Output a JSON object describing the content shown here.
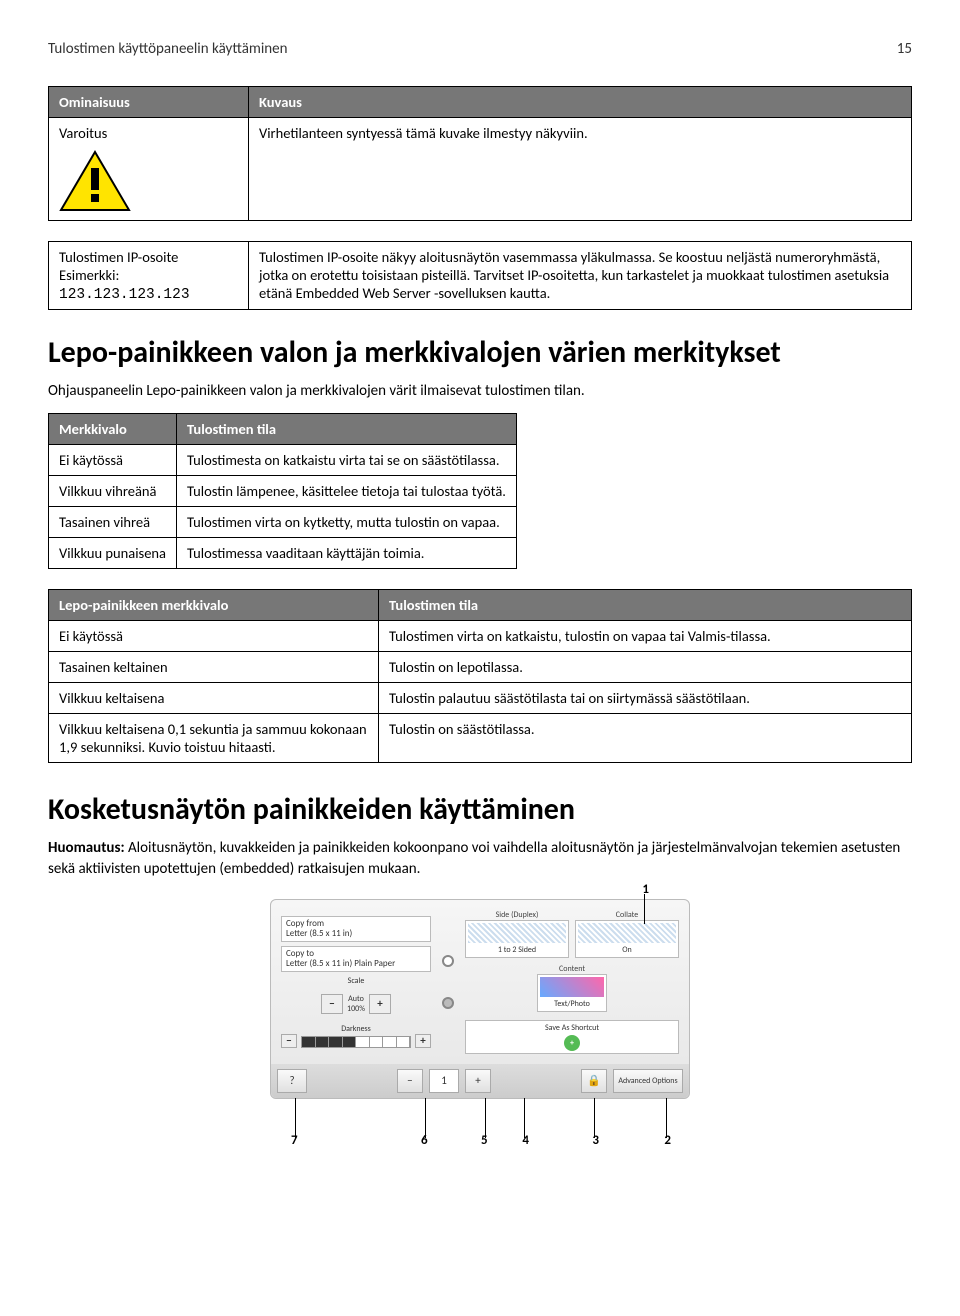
{
  "header": {
    "title": "Tulostimen käyttöpaneelin käyttäminen",
    "page": "15"
  },
  "table1": {
    "col1": "Ominaisuus",
    "col2": "Kuvaus",
    "row1_feature": "Varoitus",
    "row1_desc": "Virhetilanteen syntyessä tämä kuvake ilmestyy näkyviin."
  },
  "table2": {
    "row1_col1_line1": "Tulostimen IP-osoite",
    "row1_col1_line2_prefix": "Esimerkki: ",
    "row1_col1_line2_ip": "123.123.123.123",
    "row1_desc": "Tulostimen IP-osoite näkyy aloitusnäytön vasemmassa yläkulmassa. Se koostuu neljästä numeroryhmästä, jotka on erotettu toisistaan pisteillä. Tarvitset IP-osoitetta, kun tarkastelet ja muokkaat tulostimen asetuksia etänä Embedded Web Server -sovelluksen kautta."
  },
  "h1": "Lepo-painikkeen valon ja merkkivalojen värien merkitykset",
  "p1": "Ohjauspaneelin Lepo-painikkeen valon ja merkkivalojen värit ilmaisevat tulostimen tilan.",
  "table3": {
    "h1": "Merkkivalo",
    "h2": "Tulostimen tila",
    "rows": [
      {
        "a": "Ei käytössä",
        "b": "Tulostimesta on katkaistu virta tai se on säästötilassa."
      },
      {
        "a": "Vilkkuu vihreänä",
        "b": "Tulostin lämpenee, käsittelee tietoja tai tulostaa työtä."
      },
      {
        "a": "Tasainen vihreä",
        "b": "Tulostimen virta on kytketty, mutta tulostin on vapaa."
      },
      {
        "a": "Vilkkuu punaisena",
        "b": "Tulostimessa vaaditaan käyttäjän toimia."
      }
    ]
  },
  "table4": {
    "h1": "Lepo-painikkeen merkkivalo",
    "h2": "Tulostimen tila",
    "rows": [
      {
        "a": "Ei käytössä",
        "b": "Tulostimen virta on katkaistu, tulostin on vapaa tai Valmis-tilassa."
      },
      {
        "a": "Tasainen keltainen",
        "b": "Tulostin on lepotilassa."
      },
      {
        "a": "Vilkkuu keltaisena",
        "b": "Tulostin palautuu säästötilasta tai on siirtymässä säästötilaan."
      },
      {
        "a": "Vilkkuu keltaisena 0,1 sekuntia ja sammuu kokonaan 1,9 sekunniksi. Kuvio toistuu hitaasti.",
        "b": "Tulostin on säästötilassa."
      }
    ]
  },
  "h2": "Kosketusnäytön painikkeiden käyttäminen",
  "p2_prefix": "Huomautus:",
  "p2_rest": " Aloitusnäytön, kuvakkeiden ja painikkeiden kokoonpano voi vaihdella aloitusnäytön ja järjestelmänvalvojan tekemien asetusten sekä aktiivisten upotettujen (embedded) ratkaisujen mukaan.",
  "touchscreen": {
    "copy_from_label": "Copy from",
    "copy_from_value": "Letter (8.5 x 11 in)",
    "copy_to_label": "Copy to",
    "copy_to_value": "Letter (8.5 x 11 in) Plain Paper",
    "scale_label": "Scale",
    "scale_auto": "Auto",
    "scale_value": "100%",
    "darkness": "Darkness",
    "side_label": "Side (Duplex)",
    "side_value": "1 to 2 Sided",
    "collate_label": "Collate",
    "collate_value": "On",
    "content_label": "Content",
    "content_value": "Text/Photo",
    "save_shortcut": "Save As Shortcut",
    "advanced": "Advanced Options",
    "bottom_count": "1",
    "c1": "1",
    "c2": "2",
    "c3": "3",
    "c4": "4",
    "c5": "5",
    "c6": "6",
    "c7": "7"
  }
}
